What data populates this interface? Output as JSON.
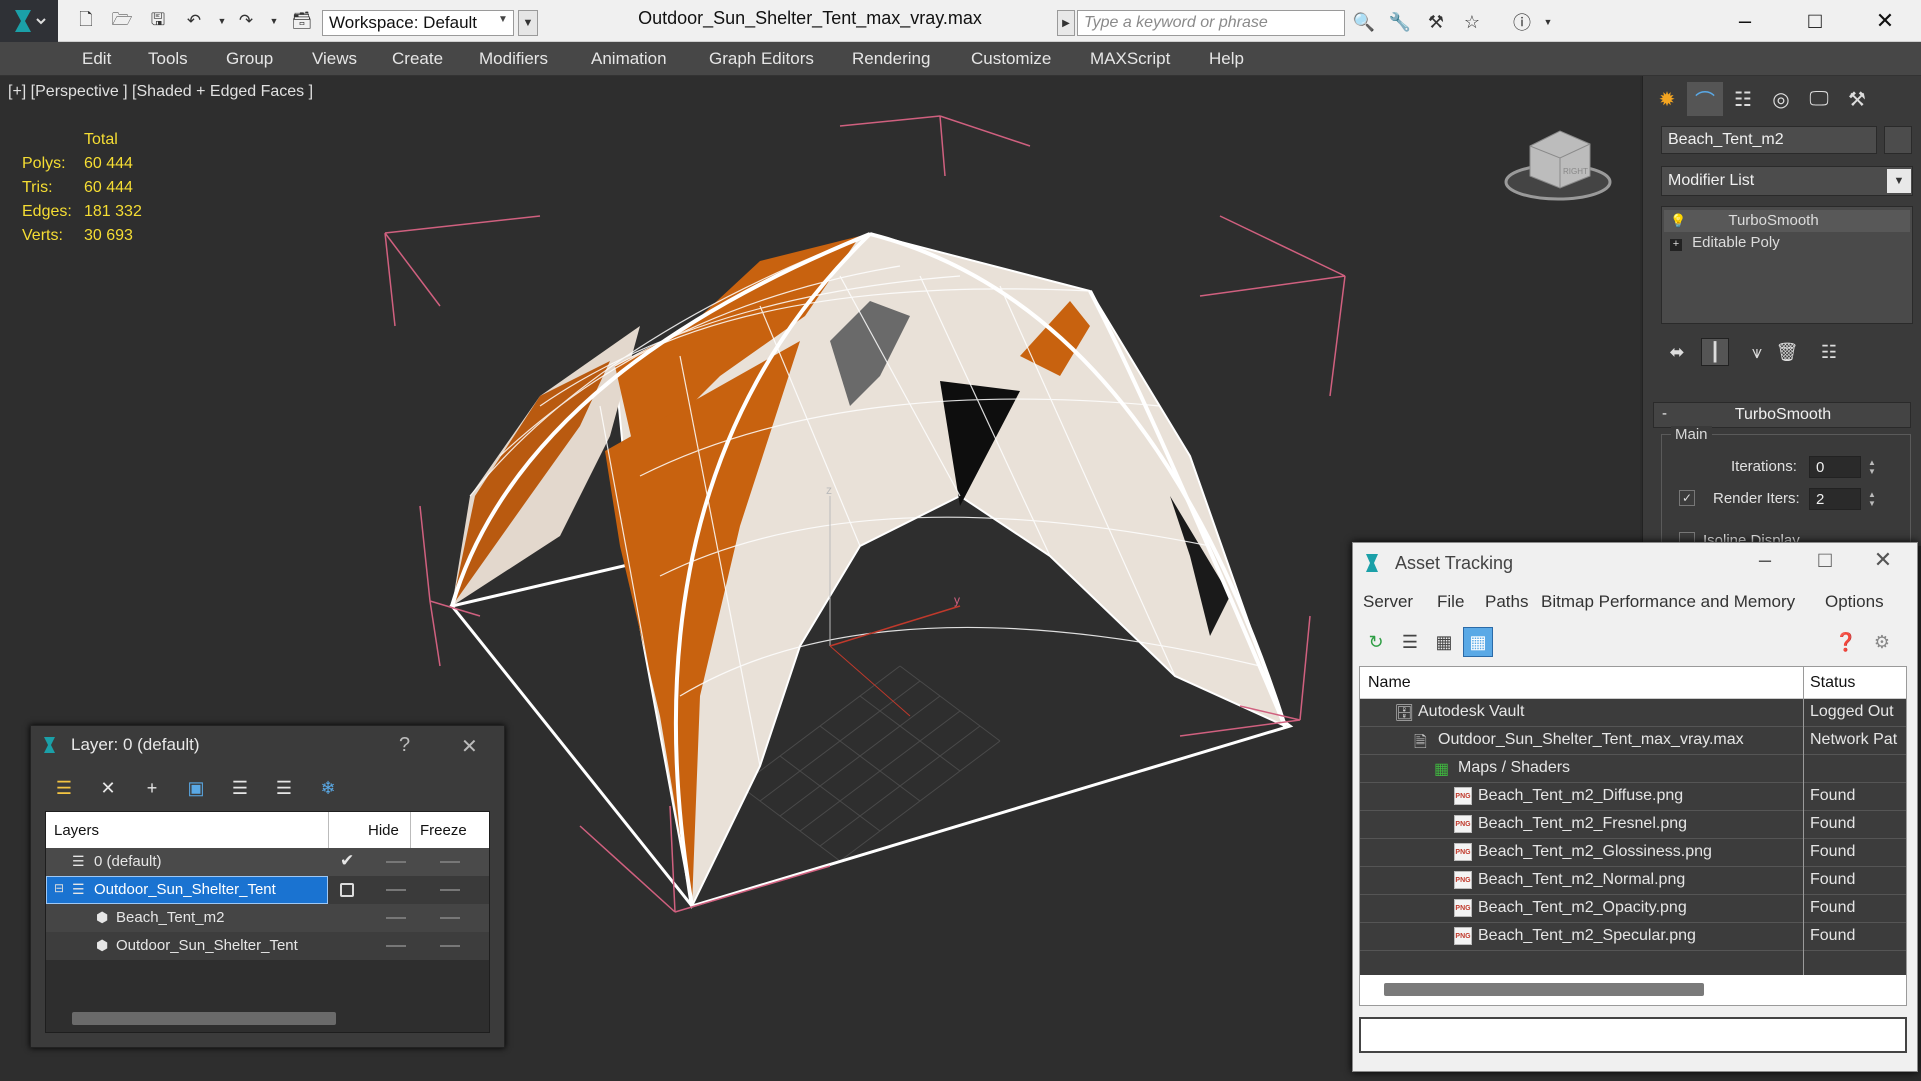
{
  "titlebar": {
    "workspace": "Workspace: Default",
    "document_title": "Outdoor_Sun_Shelter_Tent_max_vray.max",
    "search_placeholder": "Type a keyword or phrase"
  },
  "menubar": [
    "Edit",
    "Tools",
    "Group",
    "Views",
    "Create",
    "Modifiers",
    "Animation",
    "Graph Editors",
    "Rendering",
    "Customize",
    "MAXScript",
    "Help"
  ],
  "viewport": {
    "label": "[+] [Perspective ] [Shaded + Edged Faces ]",
    "stats_header": "Total",
    "stats": [
      {
        "key": "Polys:",
        "value": "60 444"
      },
      {
        "key": "Tris:",
        "value": "60 444"
      },
      {
        "key": "Edges:",
        "value": "181 332"
      },
      {
        "key": "Verts:",
        "value": "30 693"
      }
    ],
    "axis_z": "z",
    "axis_y": "y",
    "viewcube_face": "RIGHT"
  },
  "command_panel": {
    "object_name": "Beach_Tent_m2",
    "modifier_list": "Modifier List",
    "stack": [
      "TurboSmooth",
      "Editable Poly"
    ],
    "rollout_title": "TurboSmooth",
    "group_main": "Main",
    "iterations_label": "Iterations:",
    "iterations_value": "0",
    "render_iters_label": "Render Iters:",
    "render_iters_value": "2",
    "render_iters_checked": true,
    "isoline_label": "Isoline Display"
  },
  "layer_dialog": {
    "title": "Layer: 0 (default)",
    "help": "?",
    "columns": {
      "name": "Layers",
      "hide": "Hide",
      "freeze": "Freeze"
    },
    "rows": [
      {
        "name": "0 (default)",
        "level": 0,
        "active": true,
        "selected": false
      },
      {
        "name": "Outdoor_Sun_Shelter_Tent",
        "level": 0,
        "active": false,
        "selected": true
      },
      {
        "name": "Beach_Tent_m2",
        "level": 1,
        "active": false,
        "selected": false
      },
      {
        "name": "Outdoor_Sun_Shelter_Tent",
        "level": 1,
        "active": false,
        "selected": false
      }
    ]
  },
  "asset_tracking": {
    "title": "Asset Tracking",
    "menus": [
      "Server",
      "File",
      "Paths",
      "Bitmap Performance and Memory",
      "Options"
    ],
    "columns": {
      "name": "Name",
      "status": "Status"
    },
    "rows": [
      {
        "name": "Autodesk Vault",
        "status": "Logged Out",
        "level": 1,
        "icon": "vault-icon"
      },
      {
        "name": "Outdoor_Sun_Shelter_Tent_max_vray.max",
        "status": "Network Pat",
        "level": 2,
        "icon": "max-file-icon"
      },
      {
        "name": "Maps / Shaders",
        "status": "",
        "level": 3,
        "icon": "maps-icon"
      },
      {
        "name": "Beach_Tent_m2_Diffuse.png",
        "status": "Found",
        "level": 4,
        "icon": "png-icon"
      },
      {
        "name": "Beach_Tent_m2_Fresnel.png",
        "status": "Found",
        "level": 4,
        "icon": "png-icon"
      },
      {
        "name": "Beach_Tent_m2_Glossiness.png",
        "status": "Found",
        "level": 4,
        "icon": "png-icon"
      },
      {
        "name": "Beach_Tent_m2_Normal.png",
        "status": "Found",
        "level": 4,
        "icon": "png-icon"
      },
      {
        "name": "Beach_Tent_m2_Opacity.png",
        "status": "Found",
        "level": 4,
        "icon": "png-icon"
      },
      {
        "name": "Beach_Tent_m2_Specular.png",
        "status": "Found",
        "level": 4,
        "icon": "png-icon"
      }
    ],
    "png_label": "PNG"
  },
  "colors": {
    "stats_yellow": "#f5dd33",
    "tent_orange": "#c8620f",
    "tent_white": "#e9e1d8",
    "selection_blue": "#1a73d1",
    "bbox_pink": "#d0607f"
  }
}
